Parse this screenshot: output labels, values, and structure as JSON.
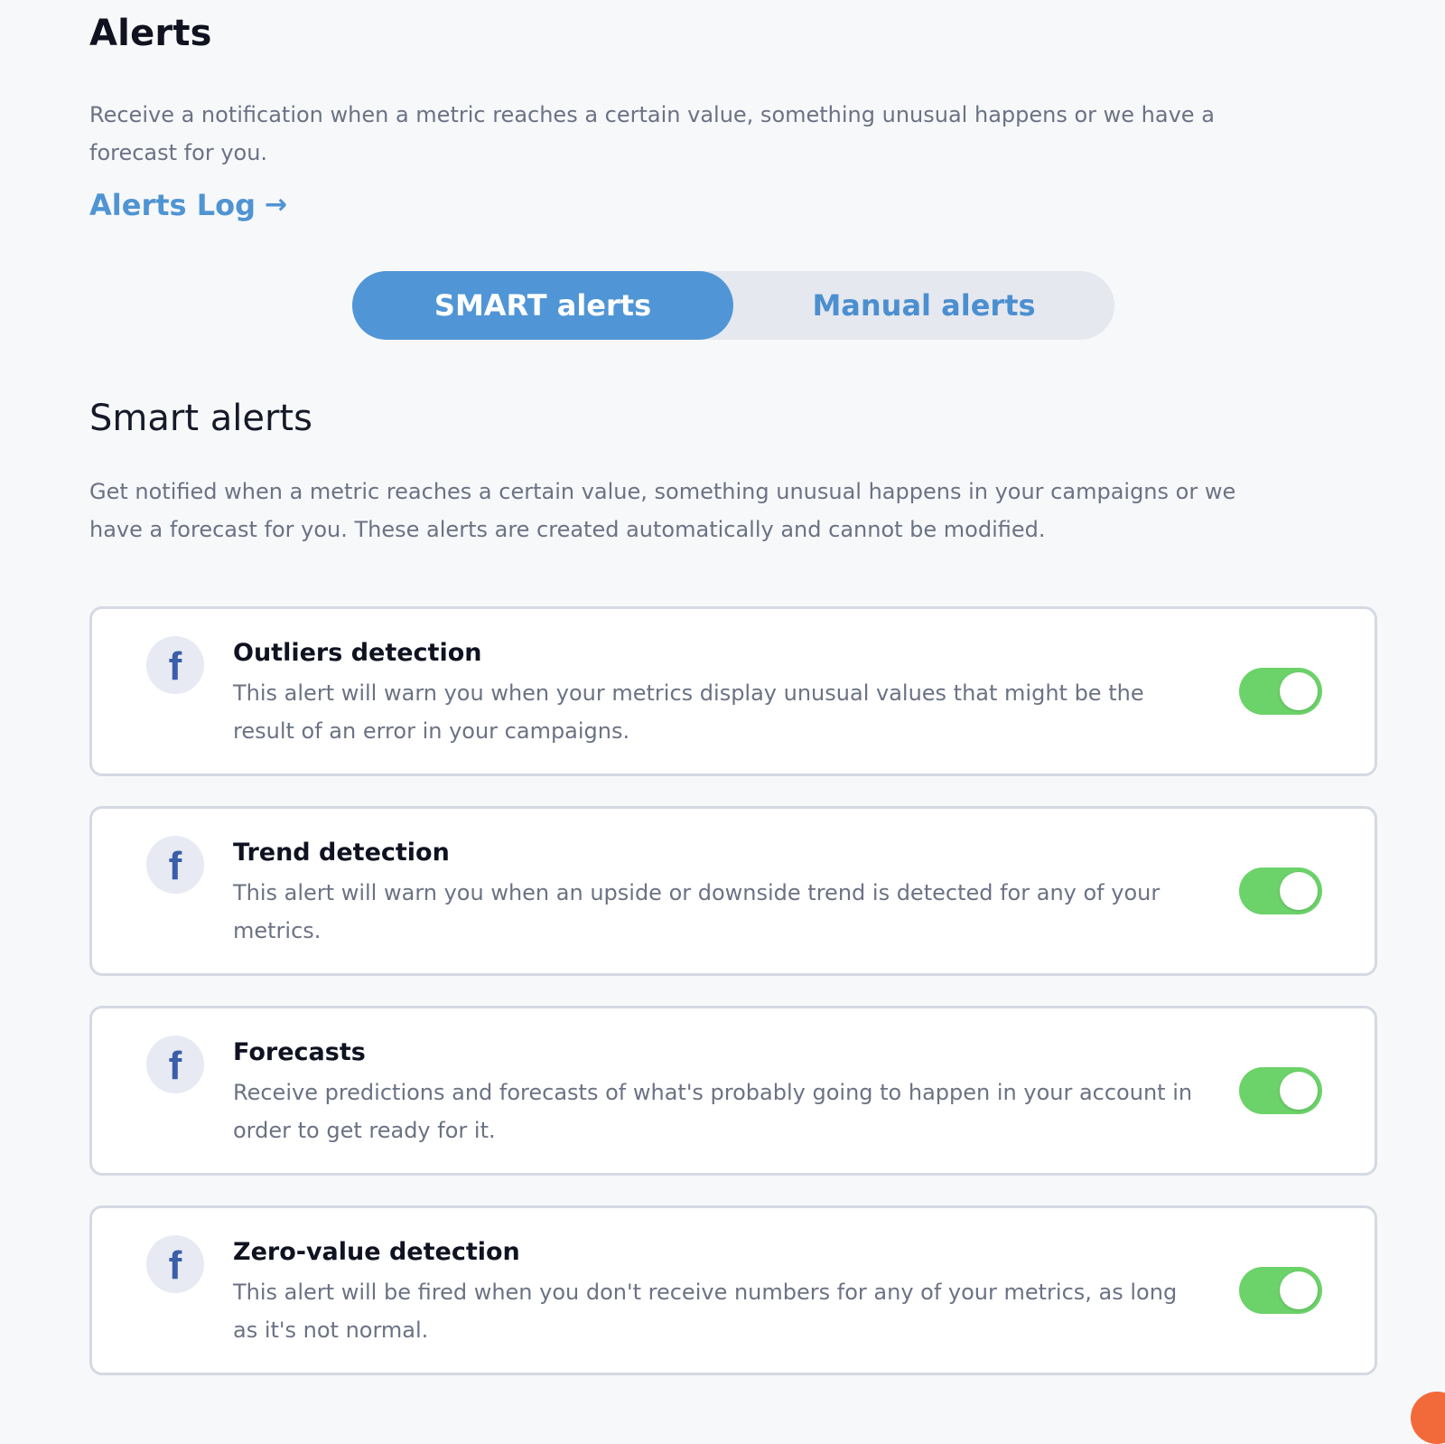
{
  "header": {
    "title": "Alerts",
    "description": "Receive a notification when a metric reaches a certain value, something unusual happens or we have a forecast for you.",
    "log_link_label": "Alerts Log",
    "log_link_arrow": "→"
  },
  "tabs": [
    {
      "label": "SMART alerts",
      "active": true
    },
    {
      "label": "Manual alerts",
      "active": false
    }
  ],
  "section": {
    "title": "Smart alerts",
    "description": "Get notified when a metric reaches a certain value, something unusual happens in your campaigns or we have a forecast for you. These alerts are created automatically and cannot be modified."
  },
  "alerts": [
    {
      "icon": "facebook-icon",
      "icon_glyph": "f",
      "title": "Outliers detection",
      "description": "This alert will warn you when your metrics display unusual values that might be the result of an error in your campaigns.",
      "enabled": true
    },
    {
      "icon": "facebook-icon",
      "icon_glyph": "f",
      "title": "Trend detection",
      "description": "This alert will warn you when an upside or downside trend is detected for any of your metrics.",
      "enabled": true
    },
    {
      "icon": "facebook-icon",
      "icon_glyph": "f",
      "title": "Forecasts",
      "description": "Receive predictions and forecasts of what's probably going to happen in your account in order to get ready for it.",
      "enabled": true
    },
    {
      "icon": "facebook-icon",
      "icon_glyph": "f",
      "title": "Zero-value detection",
      "description": "This alert will be fired when you don't receive numbers for any of your metrics, as long as it's not normal.",
      "enabled": true
    }
  ],
  "colors": {
    "accent": "#5096d6",
    "link": "#4f94d3",
    "toggle_on": "#6cd26a",
    "facebook_blue": "#3b5ea8",
    "corner_widget": "#f26a3a"
  }
}
